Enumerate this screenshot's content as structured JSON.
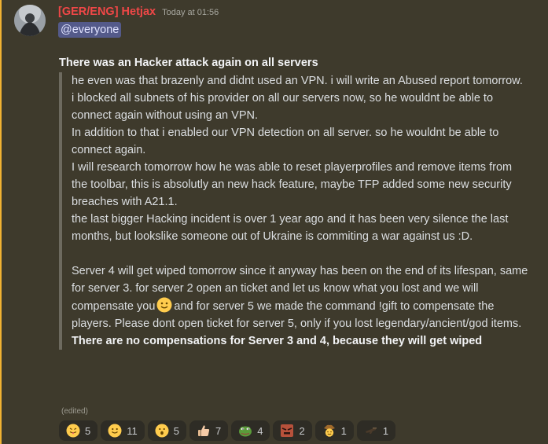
{
  "message": {
    "username": "[GER/ENG] Hetjax",
    "timestamp": "Today at 01:56",
    "mention": "@everyone",
    "title": "There was an Hacker attack again on all servers",
    "quote_lines": [
      "he even was that brazenly and didnt used an VPN. i will write an Abused report tomorrow.",
      "i blocked all subnets of his provider on all our servers now, so he wouldnt be able to connect again without using an VPN.",
      "In addition to that i enabled our VPN detection on all server. so he wouldnt be able to connect again.",
      "I will research tomorrow how he was able to reset playerprofiles and remove items from the toolbar, this is absolutly an new hack feature, maybe TFP added some new security breaches with A21.1.",
      "the last bigger Hacking incident is over 1 year ago and it has been very silence the last months, but lookslike someone out of Ukraine is commiting a war against us :D."
    ],
    "para2_before_emoji": "Server 4 will get wiped tomorrow since it anyway has been on the end of its lifespan, same for server 3. for server 2  open an ticket and let us know what you lost and we will compensate you",
    "para2_after_emoji": "and for server 5 we made the command !gift to compensate the players. Please dont open ticket for server 5, only if you lost legendary/ancient/god items.",
    "bold_closing": "There are no compensations for Server 3 and 4, because they will get wiped",
    "edited_label": "(edited)",
    "inline_emoji": "slightly-smiling-face"
  },
  "reactions": [
    {
      "emoji": "tongue-face",
      "count": "5"
    },
    {
      "emoji": "smiling-face",
      "count": "11"
    },
    {
      "emoji": "surprised-face",
      "count": "5"
    },
    {
      "emoji": "thumbs-up",
      "count": "7"
    },
    {
      "emoji": "pepe-frog",
      "count": "4"
    },
    {
      "emoji": "angry-custom",
      "count": "2"
    },
    {
      "emoji": "cowboy-custom",
      "count": "1"
    },
    {
      "emoji": "gun-custom",
      "count": "1"
    }
  ],
  "colors": {
    "username": "#f04747",
    "mention_bg": "#545a8a",
    "highlight_border": "#f0b232",
    "background": "#3e3a2c"
  }
}
